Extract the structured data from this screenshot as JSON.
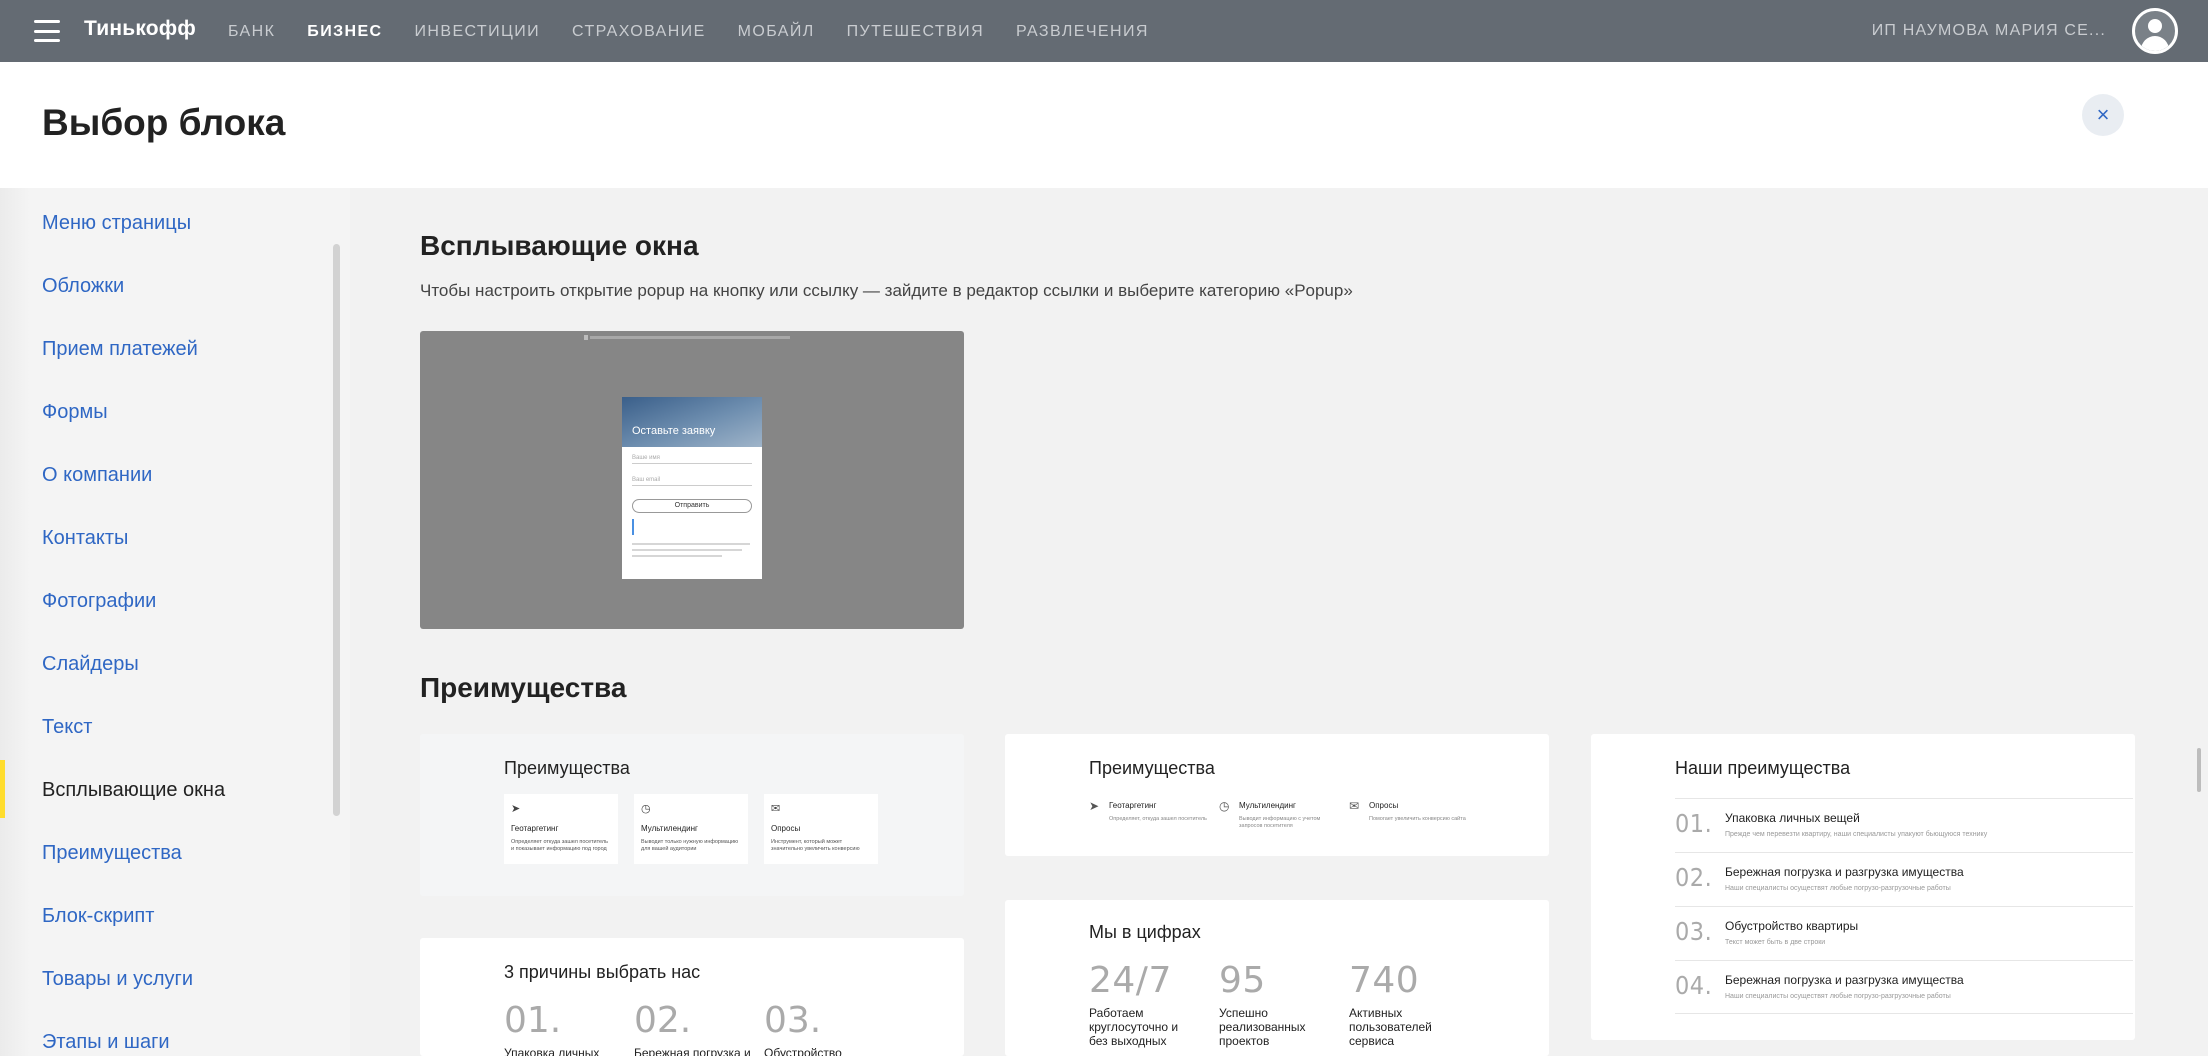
{
  "topbar": {
    "logo": "Тинькофф",
    "nav": [
      {
        "label": "БАНК",
        "active": false
      },
      {
        "label": "БИЗНЕС",
        "active": true
      },
      {
        "label": "ИНВЕСТИЦИИ",
        "active": false
      },
      {
        "label": "СТРАХОВАНИЕ",
        "active": false
      },
      {
        "label": "МОБАЙЛ",
        "active": false
      },
      {
        "label": "ПУТЕШЕСТВИЯ",
        "active": false
      },
      {
        "label": "РАЗВЛЕЧЕНИЯ",
        "active": false
      }
    ],
    "user_name": "ИП НАУМОВА МАРИЯ СЕ..."
  },
  "header": {
    "title": "Выбор блока",
    "close_icon": "×"
  },
  "sidebar": {
    "items": [
      {
        "label": "Меню страницы"
      },
      {
        "label": "Обложки"
      },
      {
        "label": "Прием платежей"
      },
      {
        "label": "Формы"
      },
      {
        "label": "О компании"
      },
      {
        "label": "Контакты"
      },
      {
        "label": "Фотографии"
      },
      {
        "label": "Слайдеры"
      },
      {
        "label": "Текст"
      },
      {
        "label": "Всплывающие окна",
        "active": true
      },
      {
        "label": "Преимущества"
      },
      {
        "label": "Блок-скрипт"
      },
      {
        "label": "Товары и услуги"
      },
      {
        "label": "Этапы и шаги"
      }
    ],
    "accent_color": "#ffdd2d"
  },
  "popups": {
    "title": "Всплывающие окна",
    "description": "Чтобы настроить открытие popup на кнопку или ссылку — зайдите в редактор ссылки и выберите категорию «Popup»",
    "preview": {
      "modal_title": "Оставьте заявку",
      "name_placeholder": "Ваше имя",
      "email_placeholder": "Ваш email",
      "button": "Отправить"
    }
  },
  "advantages": {
    "title": "Преимущества",
    "card1": {
      "title": "Преимущества",
      "items": [
        {
          "icon": "send-icon",
          "title": "Геотаргетинг",
          "text": "Определяет откуда зашел посетитель и показывает информацию под город"
        },
        {
          "icon": "clock-icon",
          "title": "Мультилендинг",
          "text": "Выводит только нужную информацию для вашей аудитории"
        },
        {
          "icon": "mail-icon",
          "title": "Опросы",
          "text": "Инструмент, который может значительно увеличить конверсию"
        }
      ]
    },
    "card2": {
      "title": "Преимущества",
      "items": [
        {
          "icon": "send-icon",
          "title": "Геотаргетинг",
          "text": "Определяет, откуда зашел посетитель"
        },
        {
          "icon": "clock-icon",
          "title": "Мультилендинг",
          "text": "Выводит информацию с учетом запросов посетителя"
        },
        {
          "icon": "mail-icon",
          "title": "Опросы",
          "text": "Помогает увеличить конверсию сайта"
        }
      ]
    },
    "card3": {
      "title": "Наши преимущества",
      "rows": [
        {
          "num": "01.",
          "title": "Упаковка личных вещей",
          "text": "Прежде чем перевезти квартиру, наши специалисты упакуют бьющуюся технику"
        },
        {
          "num": "02.",
          "title": "Бережная погрузка и разгрузка имущества",
          "text": "Наши специалисты осуществят любые погрузо-разгрузочные работы"
        },
        {
          "num": "03.",
          "title": "Обустройство квартиры",
          "text": "Текст может быть в две строки"
        },
        {
          "num": "04.",
          "title": "Бережная погрузка и разгрузка имущества",
          "text": "Наши специалисты осуществят любые погрузо-разгрузочные работы"
        }
      ]
    },
    "card4": {
      "title": "Мы в цифрах",
      "stats": [
        {
          "num": "24/7",
          "caption": "Работаем круглосуточно и без выходных"
        },
        {
          "num": "95",
          "caption": "Успешно реализованных проектов"
        },
        {
          "num": "740",
          "caption": "Активных пользователей сервиса"
        }
      ]
    },
    "card5": {
      "title": "3 причины выбрать нас",
      "reasons": [
        {
          "num": "01.",
          "caption": "Упаковка личных"
        },
        {
          "num": "02.",
          "caption": "Бережная погрузка и"
        },
        {
          "num": "03.",
          "caption": "Обустройство"
        }
      ]
    }
  }
}
